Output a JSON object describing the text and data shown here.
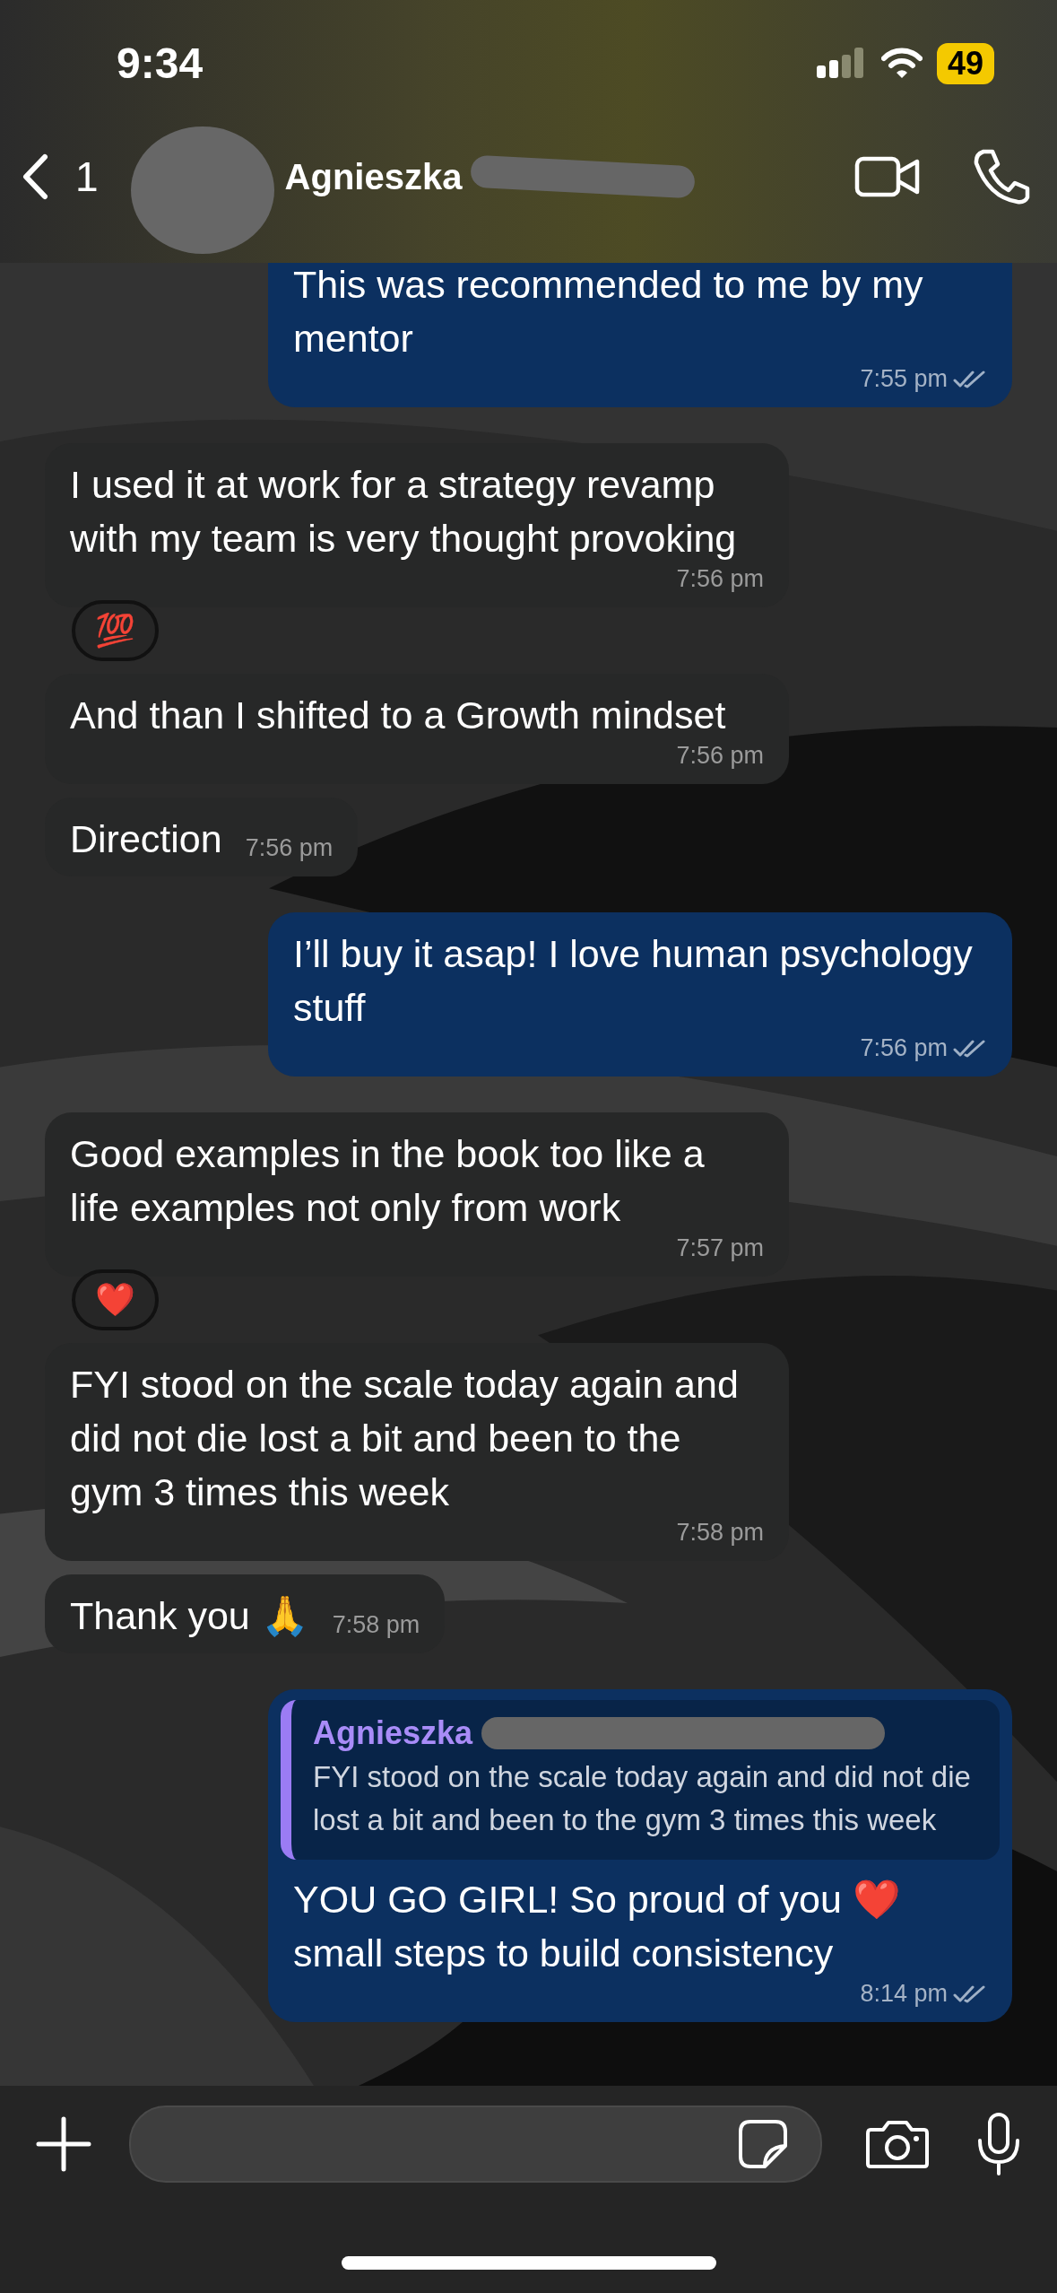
{
  "status_bar": {
    "time": "9:34",
    "battery": "49"
  },
  "header": {
    "back_count": "1",
    "contact_name": "Agnieszka"
  },
  "messages": [
    {
      "kind": "outgoing",
      "text": "This was recommended to me by my mentor",
      "time": "7:55 pm"
    },
    {
      "kind": "incoming",
      "text": "I used it at work for a strategy revamp with my team is very thought provoking",
      "time": "7:56 pm",
      "reaction": "💯"
    },
    {
      "kind": "incoming",
      "text": "And than I shifted to a Growth mindset",
      "time": "7:56 pm"
    },
    {
      "kind": "incoming",
      "text": "Direction",
      "time": "7:56 pm"
    },
    {
      "kind": "outgoing",
      "text": "I’ll buy it asap! I love human psychology stuff",
      "time": "7:56 pm"
    },
    {
      "kind": "incoming",
      "text": "Good examples in the book too like a life examples not only from work",
      "time": "7:57 pm",
      "reaction": "❤️"
    },
    {
      "kind": "incoming",
      "text": "FYI stood on the scale today again and did not die lost a bit and been to the gym 3 times this week",
      "time": "7:58 pm"
    },
    {
      "kind": "incoming",
      "text": "Thank you 🙏",
      "time": "7:58 pm"
    },
    {
      "kind": "outgoing",
      "quote": {
        "name": "Agnieszka",
        "text": "FYI stood on the scale today again and did not die lost a bit and been to the gym 3 times this week"
      },
      "text": "YOU GO GIRL! So proud of you ❤️ small steps to build consistency",
      "time": "8:14 pm"
    }
  ]
}
